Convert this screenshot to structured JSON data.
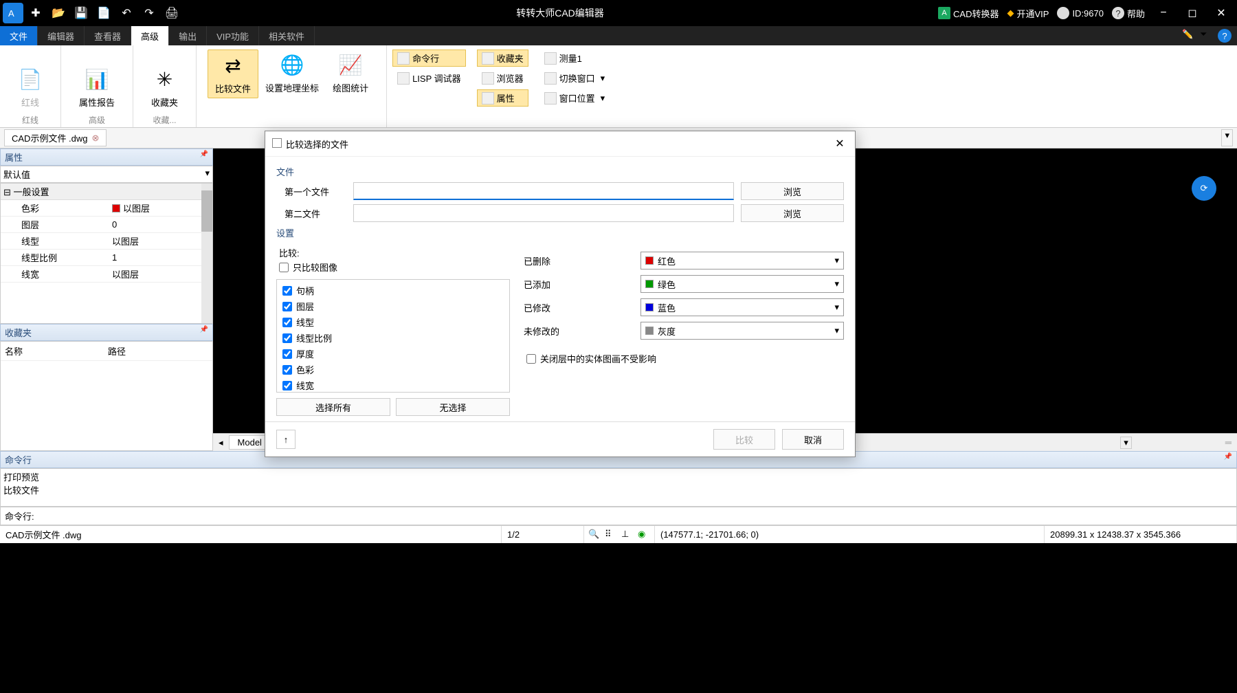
{
  "titlebar": {
    "app_title": "转转大师CAD编辑器",
    "cad_converter": "CAD转换器",
    "vip": "开通VIP",
    "user_id": "ID:9670",
    "help": "帮助"
  },
  "menu": {
    "file": "文件",
    "editor": "编辑器",
    "viewer": "查看器",
    "advanced": "高级",
    "output": "输出",
    "vip_func": "VIP功能",
    "related": "相关软件"
  },
  "ribbon": {
    "redline": "红线",
    "redline_grp": "红线",
    "attr_report": "属性报告",
    "advanced_grp": "高级",
    "favorites": "收藏夹",
    "favorites_grp": "收藏...",
    "compare_files": "比较文件",
    "set_geo": "设置地理坐标",
    "draw_stats": "绘图统计",
    "cmdline": "命令行",
    "lisp_debug": "LISP 调试器",
    "fav_small": "收藏夹",
    "browser": "浏览器",
    "properties": "属性",
    "measure": "测量1",
    "switch_win": "切换窗口",
    "win_pos": "窗口位置"
  },
  "doctab": {
    "name": "CAD示例文件 .dwg"
  },
  "panels": {
    "properties": "属性",
    "default_val": "默认值",
    "general": "一般设置",
    "color": "色彩",
    "color_val": "以图层",
    "layer": "图层",
    "layer_val": "0",
    "linetype": "线型",
    "linetype_val": "以图层",
    "lt_scale": "线型比例",
    "lt_scale_val": "1",
    "lineweight": "线宽",
    "lineweight_val": "以图层",
    "favorites": "收藏夹",
    "name_col": "名称",
    "path_col": "路径"
  },
  "model_tab": "Model",
  "dialog": {
    "title": "比较选择的文件",
    "files_section": "文件",
    "first_file": "第一个文件",
    "second_file": "第二文件",
    "browse": "浏览",
    "settings_section": "设置",
    "compare_lbl": "比较:",
    "only_image": "只比较图像",
    "chk_handle": "句柄",
    "chk_layer": "图层",
    "chk_linetype": "线型",
    "chk_ltscale": "线型比例",
    "chk_thick": "厚度",
    "chk_color": "色彩",
    "chk_lw": "线宽",
    "select_all": "选择所有",
    "select_none": "无选择",
    "deleted": "已删除",
    "added": "已添加",
    "modified": "已修改",
    "unmodified": "未修改的",
    "red": "红色",
    "green": "绿色",
    "blue": "蓝色",
    "gray": "灰度",
    "closed_layer": "关闭层中的实体图画不受影响",
    "compare_btn": "比较",
    "cancel_btn": "取消"
  },
  "cmd": {
    "header": "命令行",
    "log1": "打印预览",
    "log2": "比较文件",
    "prompt": "命令行:"
  },
  "status": {
    "filename": "CAD示例文件 .dwg",
    "page": "1/2",
    "coords": "(147577.1; -21701.66; 0)",
    "dims": "20899.31 x 12438.37 x 3545.366"
  }
}
